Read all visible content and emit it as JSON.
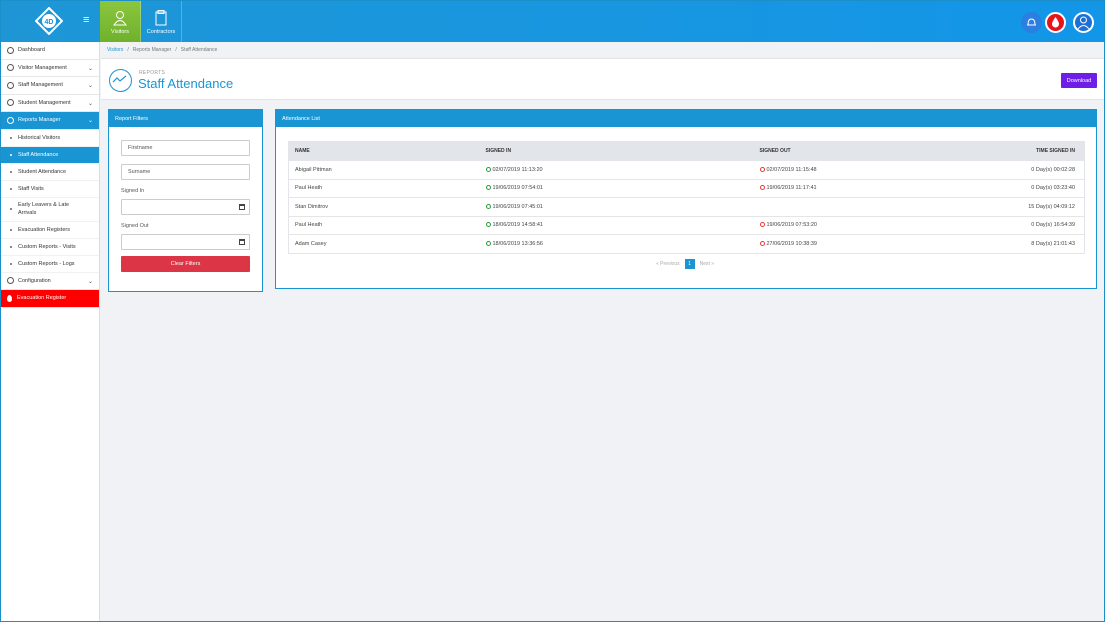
{
  "header": {
    "tabs": [
      {
        "label": "Visitors"
      },
      {
        "label": "Contractors"
      }
    ]
  },
  "sidebar": {
    "items": [
      {
        "label": "Dashboard"
      },
      {
        "label": "Visitor Management"
      },
      {
        "label": "Staff Management"
      },
      {
        "label": "Student Management"
      },
      {
        "label": "Reports Manager"
      }
    ],
    "reports_sub": [
      {
        "label": "Historical Visitors"
      },
      {
        "label": "Staff Attendance"
      },
      {
        "label": "Student Attendance"
      },
      {
        "label": "Staff Visits"
      },
      {
        "label": "Early Leavers & Late Arrivals"
      },
      {
        "label": "Evacuation Registers"
      },
      {
        "label": "Custom Reports - Visits"
      },
      {
        "label": "Custom Reports - Logs"
      }
    ],
    "configuration": "Configuration",
    "evacuation": "Evacuation Register"
  },
  "breadcrumb": [
    "Visitors",
    "Reports Manager",
    "Staff Attendance"
  ],
  "page": {
    "section": "REPORTS",
    "title": "Staff Attendance",
    "download": "Download"
  },
  "filters": {
    "title": "Report Filters",
    "firstname": "Firstname",
    "surname": "Surname",
    "signed_in_label": "Signed In",
    "signed_out_label": "Signed Out",
    "clear": "Clear Filters"
  },
  "attendance": {
    "title": "Attendance List",
    "columns": [
      "NAME",
      "SIGNED IN",
      "SIGNED OUT",
      "TIME SIGNED IN"
    ],
    "rows": [
      {
        "name": "Abigail Pittman",
        "in": "02/07/2019 11:13:20",
        "out": "02/07/2019 11:15:48",
        "time": "0 Day(s) 00:02:28"
      },
      {
        "name": "Paul Heath",
        "in": "19/06/2019 07:54:01",
        "out": "19/06/2019 11:17:41",
        "time": "0 Day(s) 03:23:40"
      },
      {
        "name": "Stan Dimitrov",
        "in": "19/06/2019 07:45:01",
        "out": "",
        "time": "15 Day(s) 04:09:12"
      },
      {
        "name": "Paul Heath",
        "in": "18/06/2019 14:58:41",
        "out": "19/06/2019 07:53:20",
        "time": "0 Day(s) 16:54:39"
      },
      {
        "name": "Adam Casey",
        "in": "18/06/2019 13:36:56",
        "out": "27/06/2019 10:38:39",
        "time": "8 Day(s) 21:01:43"
      }
    ],
    "pager": {
      "prev": "« Previous",
      "page": "1",
      "next": "Next »"
    }
  }
}
